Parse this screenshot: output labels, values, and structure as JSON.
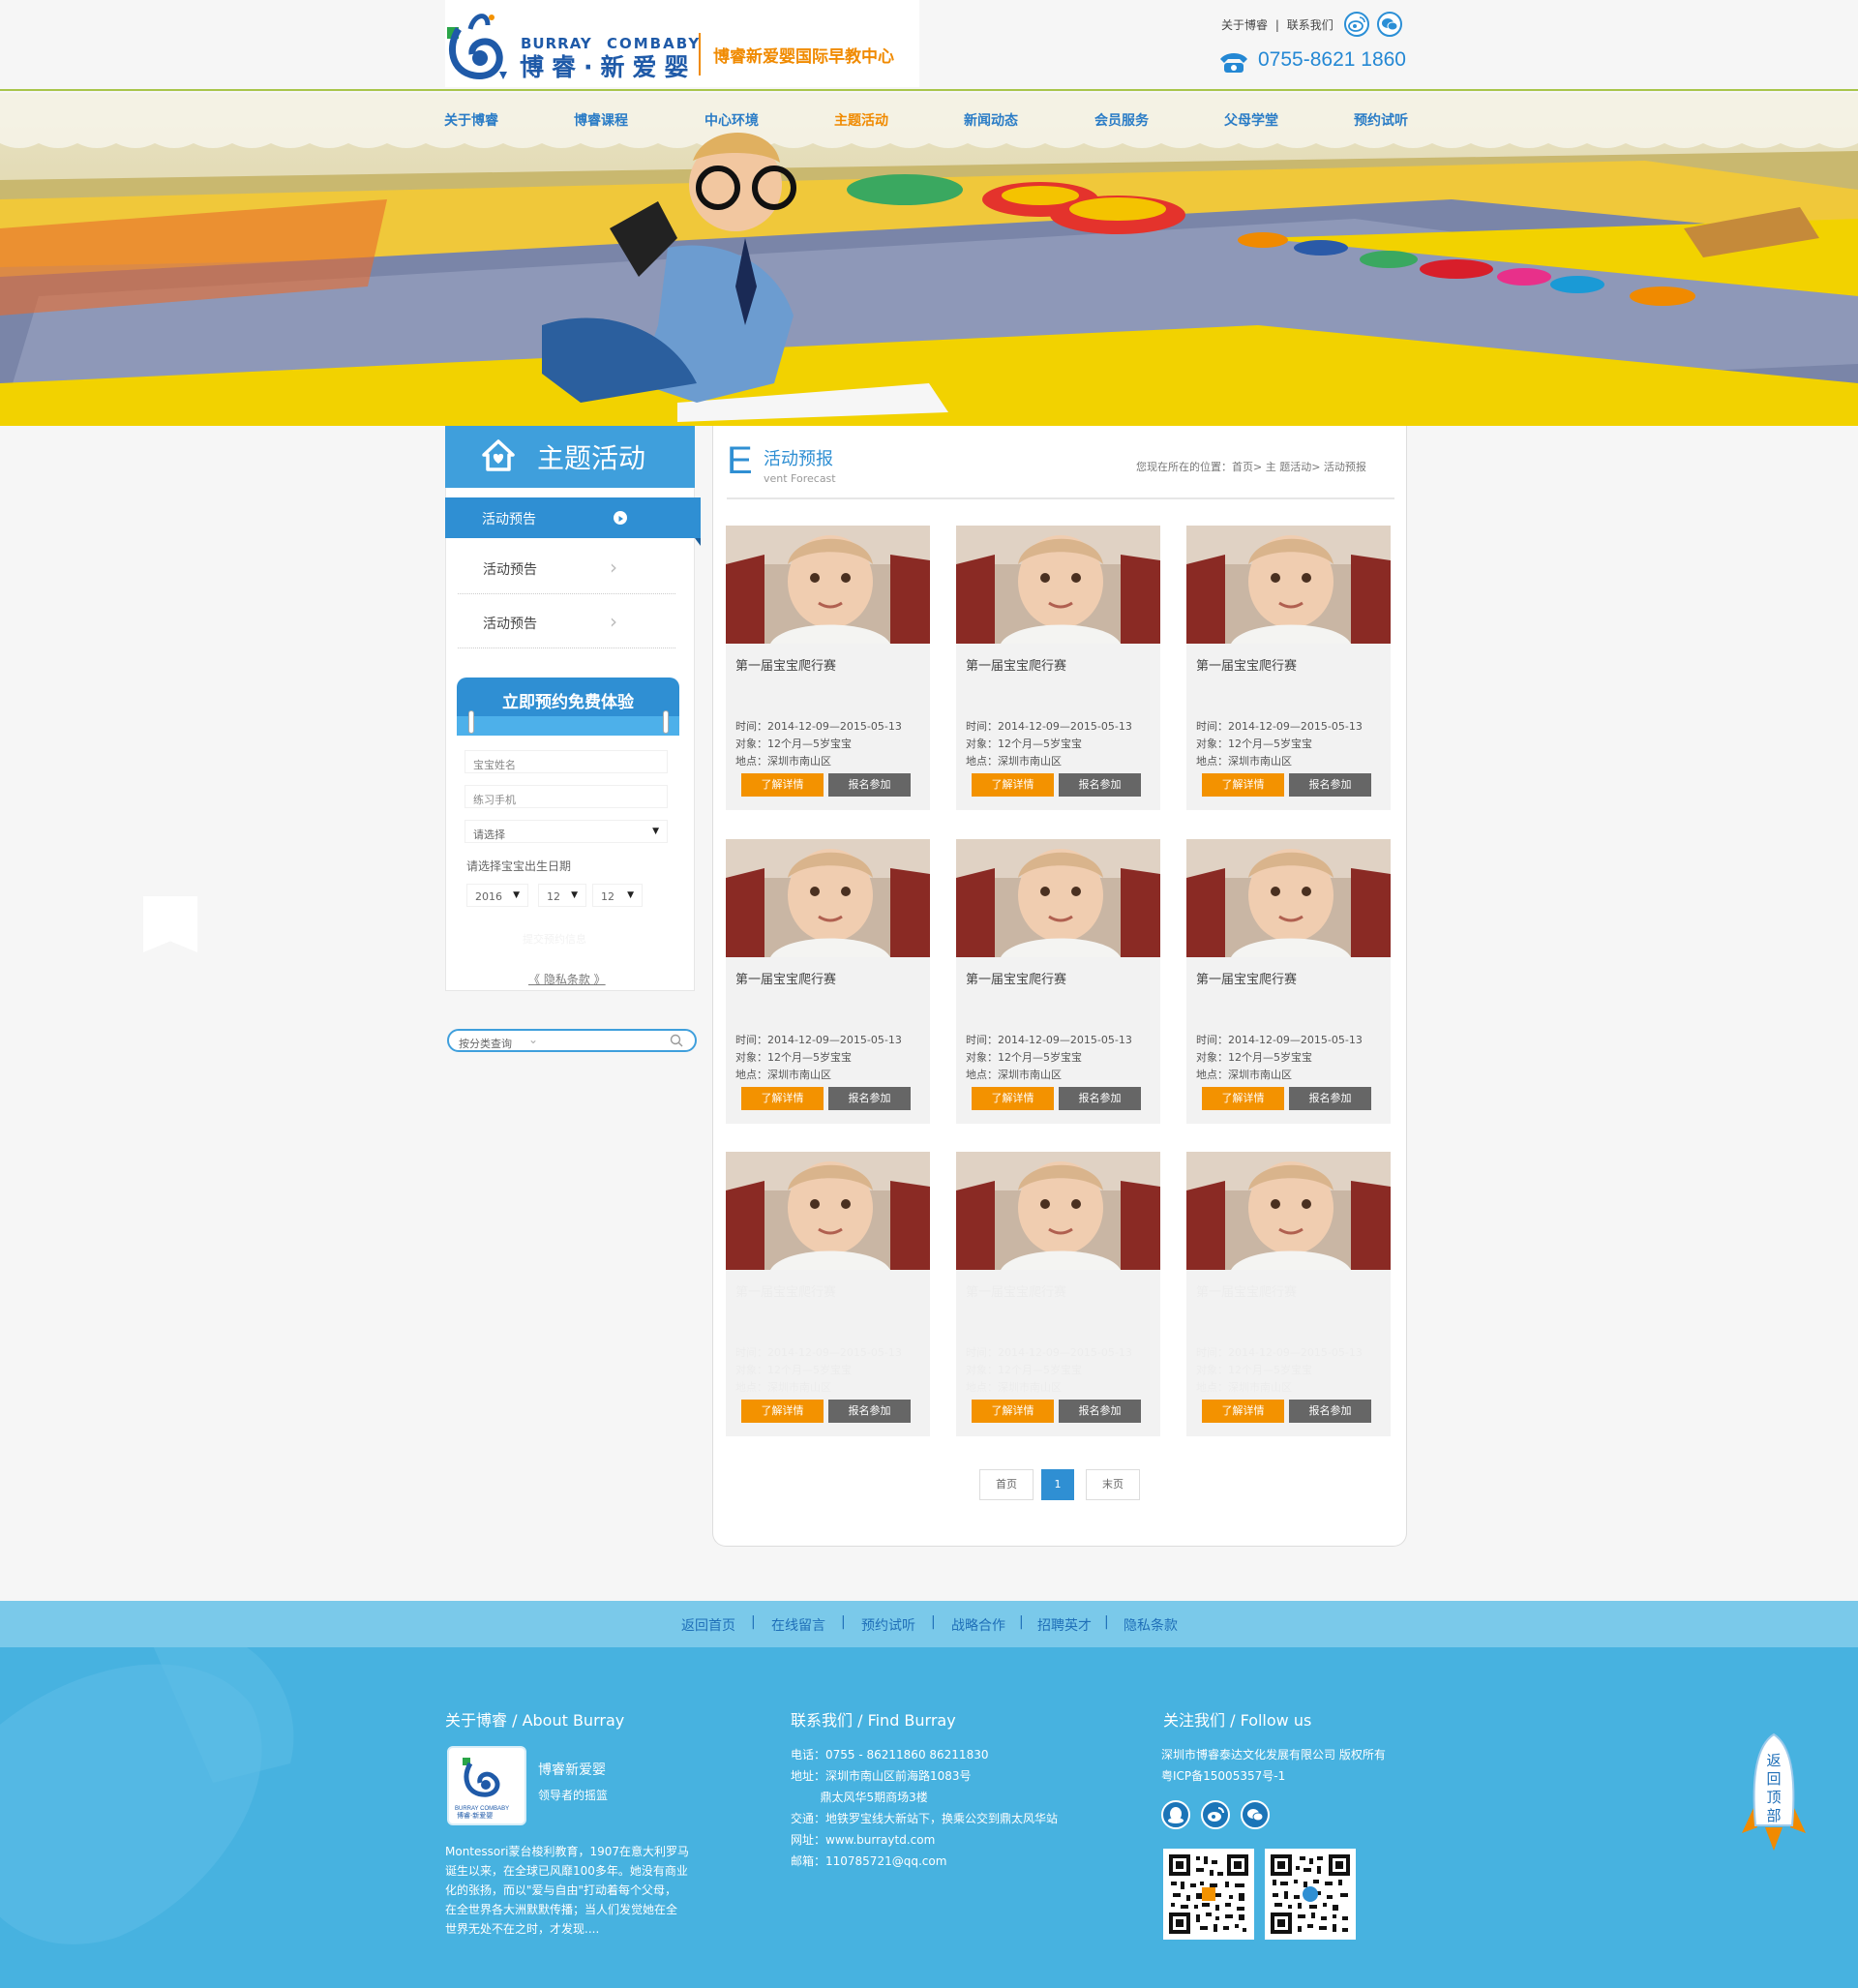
{
  "header": {
    "brand_en_1": "BURRAY",
    "brand_en_2": "COMBABY",
    "brand_cn": "博睿·新爱婴",
    "slogan": "博睿新爱婴国际早教中心",
    "top_links": [
      "关于博睿",
      "联系我们"
    ],
    "top_sep": "|",
    "hotline": "0755-8621 1860",
    "icons": [
      "weibo-icon",
      "wechat-icon",
      "phone-icon"
    ]
  },
  "nav": {
    "items": [
      "关于博睿",
      "博睿课程",
      "中心环境",
      "主题活动",
      "新闻动态",
      "会员服务",
      "父母学堂",
      "预约试听"
    ],
    "active_index": 3
  },
  "sidebar": {
    "title": "主题活动",
    "items": [
      "活动预告",
      "活动预告",
      "活动预告"
    ],
    "book": {
      "title": "立即预约免费体验",
      "baby_name_placeholder": "宝宝姓名",
      "phone_placeholder": "练习手机",
      "select_value": "请选择",
      "birth_label": "请选择宝宝出生日期",
      "year": "2016",
      "month": "12",
      "day": "12",
      "submit": "提交预约信息",
      "privacy": "《 隐私条款 》"
    },
    "search_placeholder": "按分类查询"
  },
  "main": {
    "big_letter": "E",
    "title": "活动预报",
    "subtitle": "vent Forecast",
    "breadcrumb": "您现在所在的位置：首页> 主 题活动>  活动预报",
    "cards": [
      {
        "title": "第一届宝宝爬行赛",
        "time": "时间：2014-12-09—2015-05-13",
        "target": "对象：12个月—5岁宝宝",
        "place": "地点：深圳市南山区",
        "btn_detail": "了解详情",
        "btn_join": "报名参加"
      },
      {
        "title": "第一届宝宝爬行赛",
        "time": "时间：2014-12-09—2015-05-13",
        "target": "对象：12个月—5岁宝宝",
        "place": "地点：深圳市南山区",
        "btn_detail": "了解详情",
        "btn_join": "报名参加"
      },
      {
        "title": "第一届宝宝爬行赛",
        "time": "时间：2014-12-09—2015-05-13",
        "target": "对象：12个月—5岁宝宝",
        "place": "地点：深圳市南山区",
        "btn_detail": "了解详情",
        "btn_join": "报名参加"
      },
      {
        "title": "第一届宝宝爬行赛",
        "time": "时间：2014-12-09—2015-05-13",
        "target": "对象：12个月—5岁宝宝",
        "place": "地点：深圳市南山区",
        "btn_detail": "了解详情",
        "btn_join": "报名参加"
      },
      {
        "title": "第一届宝宝爬行赛",
        "time": "时间：2014-12-09—2015-05-13",
        "target": "对象：12个月—5岁宝宝",
        "place": "地点：深圳市南山区",
        "btn_detail": "了解详情",
        "btn_join": "报名参加"
      },
      {
        "title": "第一届宝宝爬行赛",
        "time": "时间：2014-12-09—2015-05-13",
        "target": "对象：12个月—5岁宝宝",
        "place": "地点：深圳市南山区",
        "btn_detail": "了解详情",
        "btn_join": "报名参加"
      },
      {
        "title": "第一届宝宝爬行赛",
        "time": "时间：2014-12-09—2015-05-13",
        "target": "对象：12个月—5岁宝宝",
        "place": "地点：深圳市南山区",
        "btn_detail": "了解详情",
        "btn_join": "报名参加"
      },
      {
        "title": "第一届宝宝爬行赛",
        "time": "时间：2014-12-09—2015-05-13",
        "target": "对象：12个月—5岁宝宝",
        "place": "地点：深圳市南山区",
        "btn_detail": "了解详情",
        "btn_join": "报名参加"
      },
      {
        "title": "第一届宝宝爬行赛",
        "time": "时间：2014-12-09—2015-05-13",
        "target": "对象：12个月—5岁宝宝",
        "place": "地点：深圳市南山区",
        "btn_detail": "了解详情",
        "btn_join": "报名参加"
      }
    ],
    "pagination": {
      "first": "首页",
      "current": "1",
      "last": "末页"
    }
  },
  "footer_links": {
    "items": [
      "返回首页",
      "在线留言",
      "预约试听",
      "战略合作",
      "招聘英才",
      "隐私条款"
    ],
    "sep": "|"
  },
  "footer": {
    "about_title": "关于博睿 / About Burray",
    "about_name": "博睿新爱婴",
    "about_tag": "领导者的摇篮",
    "about_text": [
      "Montessori蒙台梭利教育，1907在意大利罗马",
      "诞生以来，在全球已风靡100多年。她没有商业",
      "化的张扬，而以\"爱与自由\"打动着每个父母，",
      "在全世界各大洲默默传播；当人们发觉她在全",
      "世界无处不在之时，才发现...."
    ],
    "contact_title": "联系我们 / Find Burray",
    "contact": [
      "电话：0755 - 86211860  86211830",
      "地址：深圳市南山区前海路1083号",
      "        鼎太风华5期商场3楼",
      "交通：地铁罗宝线大新站下，换乘公交到鼎太风华站",
      "网址：www.burraytd.com",
      "邮箱：110785721@qq.com"
    ],
    "follow_title": "关注我们 / Follow us",
    "copyright": [
      "深圳市博睿泰达文化发展有限公司 版权所有",
      "粤ICP备15005357号-1"
    ],
    "social_icons": [
      "qq-icon",
      "weibo-icon",
      "wechat-icon"
    ],
    "back_top": "返回顶部"
  },
  "colors": {
    "brand_blue": "#2f8fd3",
    "accent_orange": "#f39200",
    "footer_blue": "#47b2e0",
    "footer_links_bg": "#7ac9ea"
  }
}
